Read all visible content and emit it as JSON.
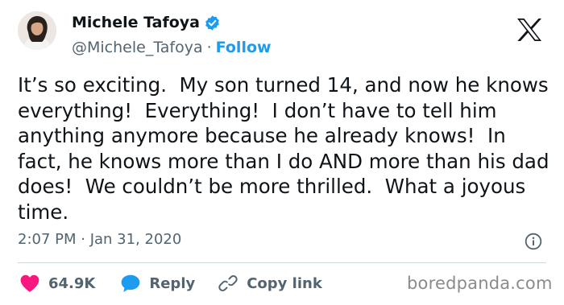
{
  "author": {
    "name": "Michele Tafoya",
    "handle": "@Michele_Tafoya",
    "separator": "·",
    "follow_label": "Follow",
    "verified": true
  },
  "tweet": {
    "text": "It’s so exciting.  My son turned 14, and now he knows everything!  Everything!  I don’t have to tell him anything anymore because he already knows!  In fact, he knows more than I do AND more than his dad does!  We couldn’t be more thrilled.  What a joyous time.",
    "timestamp": "2:07 PM · Jan 31, 2020"
  },
  "actions": {
    "like_count": "64.9K",
    "reply_label": "Reply",
    "copy_label": "Copy link"
  },
  "watermark": "boredpanda.com",
  "icons": {
    "brand": "x-logo-icon",
    "verified": "verified-badge-icon",
    "info": "info-icon",
    "like": "heart-icon",
    "reply": "speech-bubble-icon",
    "copy": "link-icon"
  },
  "colors": {
    "accent": "#1d9bf0",
    "like": "#f91880",
    "text": "#0f1419",
    "muted": "#536471"
  }
}
